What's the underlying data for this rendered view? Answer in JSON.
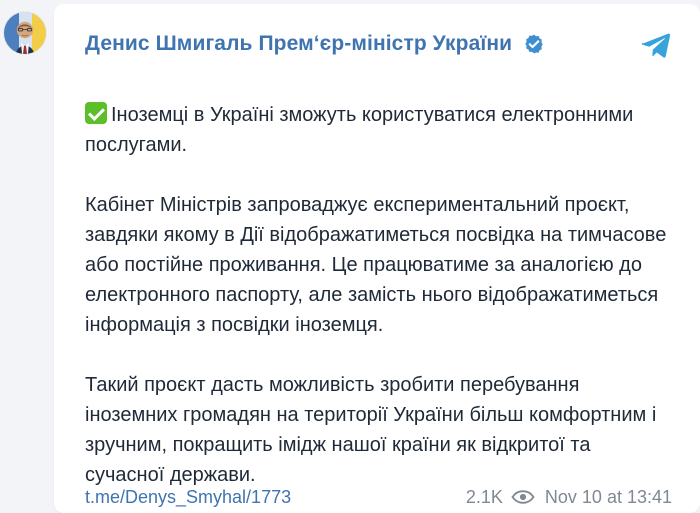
{
  "avatar": {
    "name": "avatar"
  },
  "channel": {
    "name": "Денис Шмигаль Прем‘єр-міністр України",
    "verified_icon": "verified-badge-icon",
    "app_icon": "telegram-icon"
  },
  "message": {
    "lead": "Іноземці в Україні зможуть користуватися електронними послугами.",
    "paragraph_1": "Кабінет Міністрів запроваджує експериментальний проєкт, завдяки якому в Дії відображатиметься посвідка на тимчасове або постійне проживання. Це працюватиме за аналогією до електронного паспорту, але замість нього відображатиметься інформація з посвідки іноземця.",
    "paragraph_2": "Такий проєкт дасть можливість зробити перебування іноземних громадян на території України більш комфортним і зручним, покращить імідж нашої країни як відкритої та сучасної держави."
  },
  "footer": {
    "link_text": "t.me/Denys_Smyhal/1773",
    "views": "2.1K",
    "views_icon": "eye-icon",
    "timestamp": "Nov 10 at 13:41"
  },
  "colors": {
    "accent": "#3f74b1",
    "telegram": "#36a3db",
    "verified": "#3d8fd1",
    "checkmark": "#5cbf2a"
  }
}
